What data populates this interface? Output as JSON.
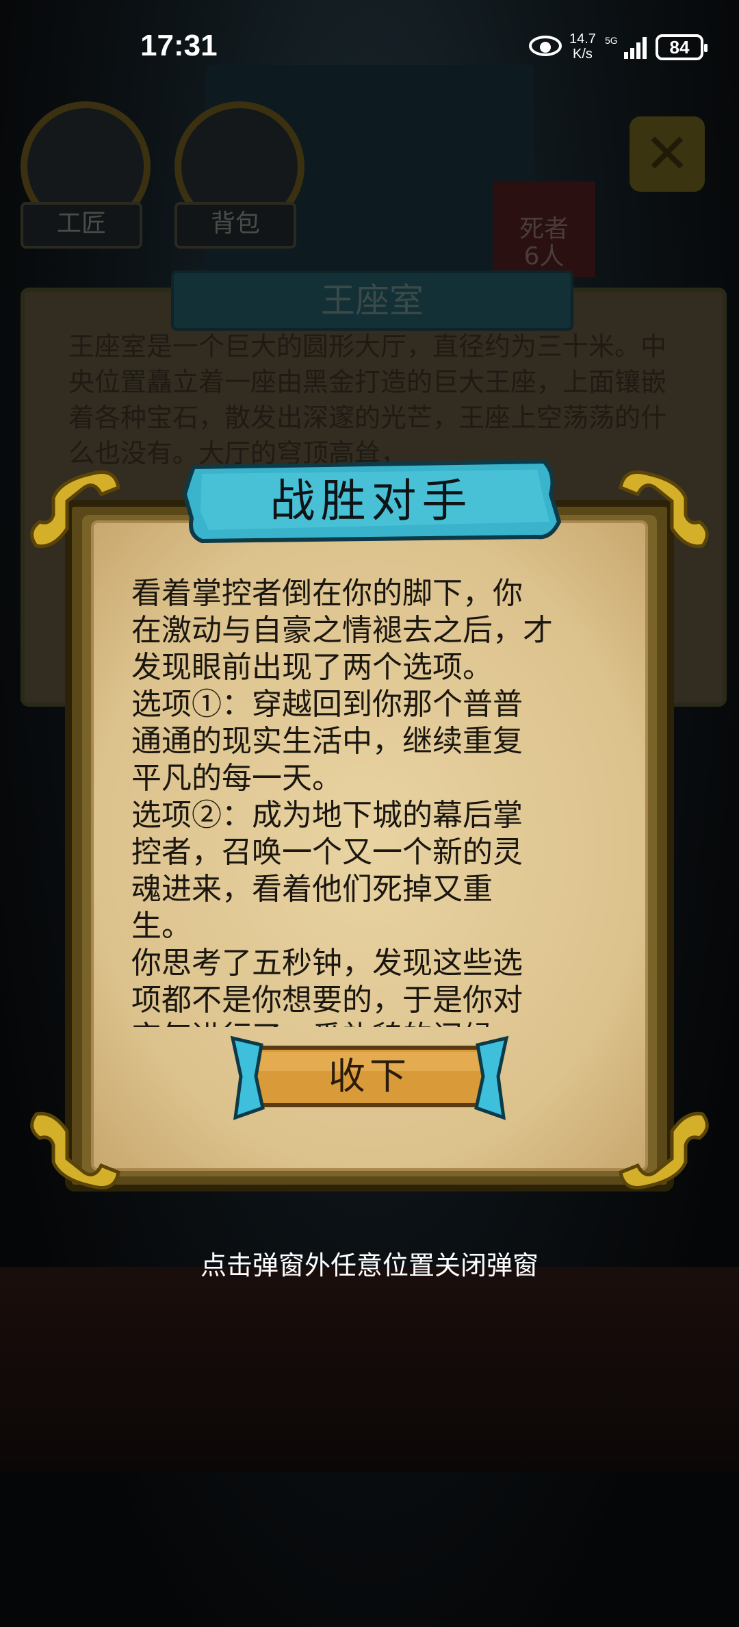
{
  "status_bar": {
    "time": "17:31",
    "net_speed_value": "14.7",
    "net_speed_unit": "K/s",
    "network": "5G",
    "battery": "84"
  },
  "background": {
    "labels": [
      "工匠",
      "背包"
    ],
    "death_count": "死者\n6人",
    "room_title": "王座室",
    "room_text": "王座室是一个巨大的圆形大厅，直径约为三十米。中央位置矗立着一座由黑金打造的巨大王座，上面镶嵌着各种宝石，散发出深邃的光芒，王座上空荡荡的什么也没有。大厅的穹顶高耸，"
  },
  "dialog": {
    "title": "战胜对手",
    "body": "看着掌控者倒在你的脚下，你\n在激动与自豪之情褪去之后，才\n发现眼前出现了两个选项。\n选项①：穿越回到你那个普普\n通通的现实生活中，继续重复\n平凡的每一天。\n选项②：成为地下城的幕后掌\n控者，召唤一个又一个新的灵\n魂进来，看着他们死掉又重\n生。\n你思考了五秒钟，发现这些选\n项都不是你想要的，于是你对\n空气进行了一番礼貌的问候。",
    "button_label": "收下"
  },
  "hint": "点击弹窗外任意位置关闭弹窗",
  "colors": {
    "parchment": "#dcc28d",
    "frame_gold": "#d4b02a",
    "banner_cyan": "#3ab4cc",
    "button_orange": "#d99a3a"
  }
}
